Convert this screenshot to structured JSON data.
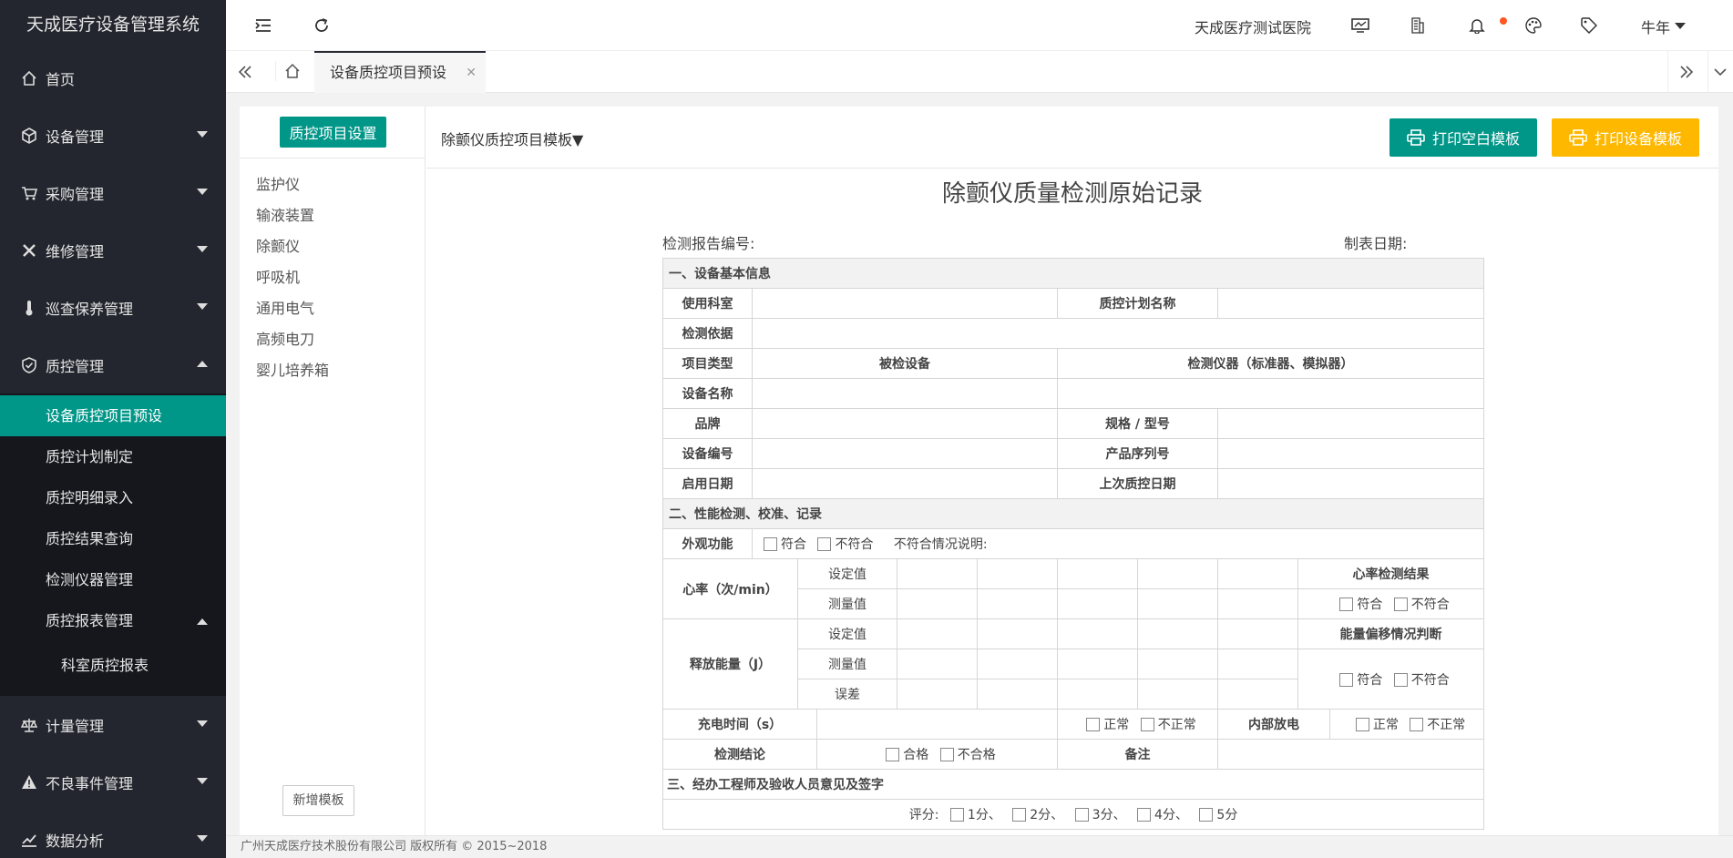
{
  "app": {
    "title": "天成医疗设备管理系统"
  },
  "nav": {
    "home": "首页",
    "device": "设备管理",
    "purchase": "采购管理",
    "repair": "维修管理",
    "patrol": "巡查保养管理",
    "qc": "质控管理",
    "qc_sub": [
      "设备质控项目预设",
      "质控计划制定",
      "质控明细录入",
      "质控结果查询",
      "检测仪器管理",
      "质控报表管理"
    ],
    "qc_subsub": "科室质控报表",
    "metrology": "计量管理",
    "adverse": "不良事件管理",
    "analysis": "数据分析"
  },
  "header": {
    "hospital": "天成医疗测试医院",
    "user": "牛年"
  },
  "tabs": {
    "active": "设备质控项目预设"
  },
  "left": {
    "setting_btn": "质控项目设置",
    "categories": [
      "监护仪",
      "输液装置",
      "除颤仪",
      "呼吸机",
      "通用电气",
      "高频电刀",
      "婴儿培养箱"
    ],
    "add_btn": "新增模板"
  },
  "toolbar": {
    "template_select": "除颤仪质控项目模板▼",
    "print_blank": "打印空白模板",
    "print_device": "打印设备模板"
  },
  "doc": {
    "title": "除颤仪质量检测原始记录",
    "report_no": "检测报告编号:",
    "date": "制表日期:",
    "sec1": "一、设备基本信息",
    "dept": "使用科室",
    "plan": "质控计划名称",
    "basis": "检测依据",
    "type": "项目类型",
    "inspected": "被检设备",
    "instrument": "检测仪器（标准器、模拟器）",
    "name": "设备名称",
    "brand": "品牌",
    "model": "规格 / 型号",
    "devno": "设备编号",
    "serial": "产品序列号",
    "start": "启用日期",
    "lastqc": "上次质控日期",
    "sec2": "二、性能检测、校准、记录",
    "appearance": "外观功能",
    "ok": "符合",
    "notok": "不符合",
    "note": "不符合情况说明:",
    "hr": "心率（次/min）",
    "set": "设定值",
    "measured": "测量值",
    "hr_result": "心率检测结果",
    "energy": "释放能量（J）",
    "deviation": "能量偏移情况判断",
    "error": "误差",
    "charge": "充电时间（s）",
    "normal": "正常",
    "abnormal": "不正常",
    "internal": "内部放电",
    "conclusion": "检测结论",
    "pass": "合格",
    "fail": "不合格",
    "remark": "备注",
    "sec3": "三、经办工程师及验收人员意见及签字",
    "score": "评分:",
    "scores": [
      "1分、",
      "2分、",
      "3分、",
      "4分、",
      "5分"
    ]
  },
  "footer": "广州天成医疗技术股份有限公司 版权所有 © 2015~2018",
  "colors": {
    "accent": "#009688",
    "warn": "#ffb800",
    "sidebar": "#23262e"
  }
}
